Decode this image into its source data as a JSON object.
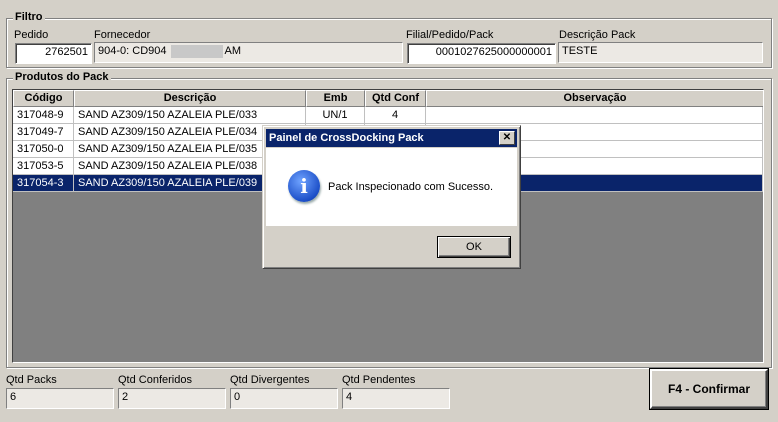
{
  "filter": {
    "title": "Filtro",
    "pedido": {
      "label": "Pedido",
      "value": "2762501"
    },
    "fornecedor": {
      "label": "Fornecedor",
      "value_prefix": "904-0: CD904",
      "value_suffix": "AM"
    },
    "filial": {
      "label": "Filial/Pedido/Pack",
      "value": "0001027625000000001"
    },
    "descricao": {
      "label": "Descrição Pack",
      "value": "TESTE"
    }
  },
  "products": {
    "title": "Produtos do Pack",
    "columns": [
      "Código",
      "Descrição",
      "Emb",
      "Qtd Conf",
      "Observação"
    ],
    "rows": [
      {
        "codigo": "317048-9",
        "descricao": "SAND AZ309/150 AZALEIA PLE/033",
        "emb": "UN/1",
        "qtd": "4",
        "obs": ""
      },
      {
        "codigo": "317049-7",
        "descricao": "SAND AZ309/150 AZALEIA PLE/034",
        "emb": "",
        "qtd": "",
        "obs": ""
      },
      {
        "codigo": "317050-0",
        "descricao": "SAND AZ309/150 AZALEIA PLE/035",
        "emb": "",
        "qtd": "",
        "obs": ""
      },
      {
        "codigo": "317053-5",
        "descricao": "SAND AZ309/150 AZALEIA PLE/038",
        "emb": "",
        "qtd": "",
        "obs": ""
      },
      {
        "codigo": "317054-3",
        "descricao": "SAND AZ309/150 AZALEIA PLE/039",
        "emb": "",
        "qtd": "",
        "obs": ""
      }
    ],
    "selected_row": 4
  },
  "totals": {
    "packs": {
      "label": "Qtd Packs",
      "value": "6"
    },
    "conferidos": {
      "label": "Qtd Conferidos",
      "value": "2"
    },
    "divergentes": {
      "label": "Qtd Divergentes",
      "value": "0"
    },
    "pendentes": {
      "label": "Qtd Pendentes",
      "value": "4"
    }
  },
  "confirm_button": "F4 - Confirmar",
  "dialog": {
    "title": "Painel de CrossDocking Pack",
    "close": "✕",
    "icon": "info-icon",
    "icon_glyph": "i",
    "message": "Pack Inspecionado com Sucesso.",
    "ok": "OK"
  },
  "colors": {
    "selection": "#0a246a",
    "titlebar": "#0a246a",
    "window": "#d4d0c8"
  }
}
